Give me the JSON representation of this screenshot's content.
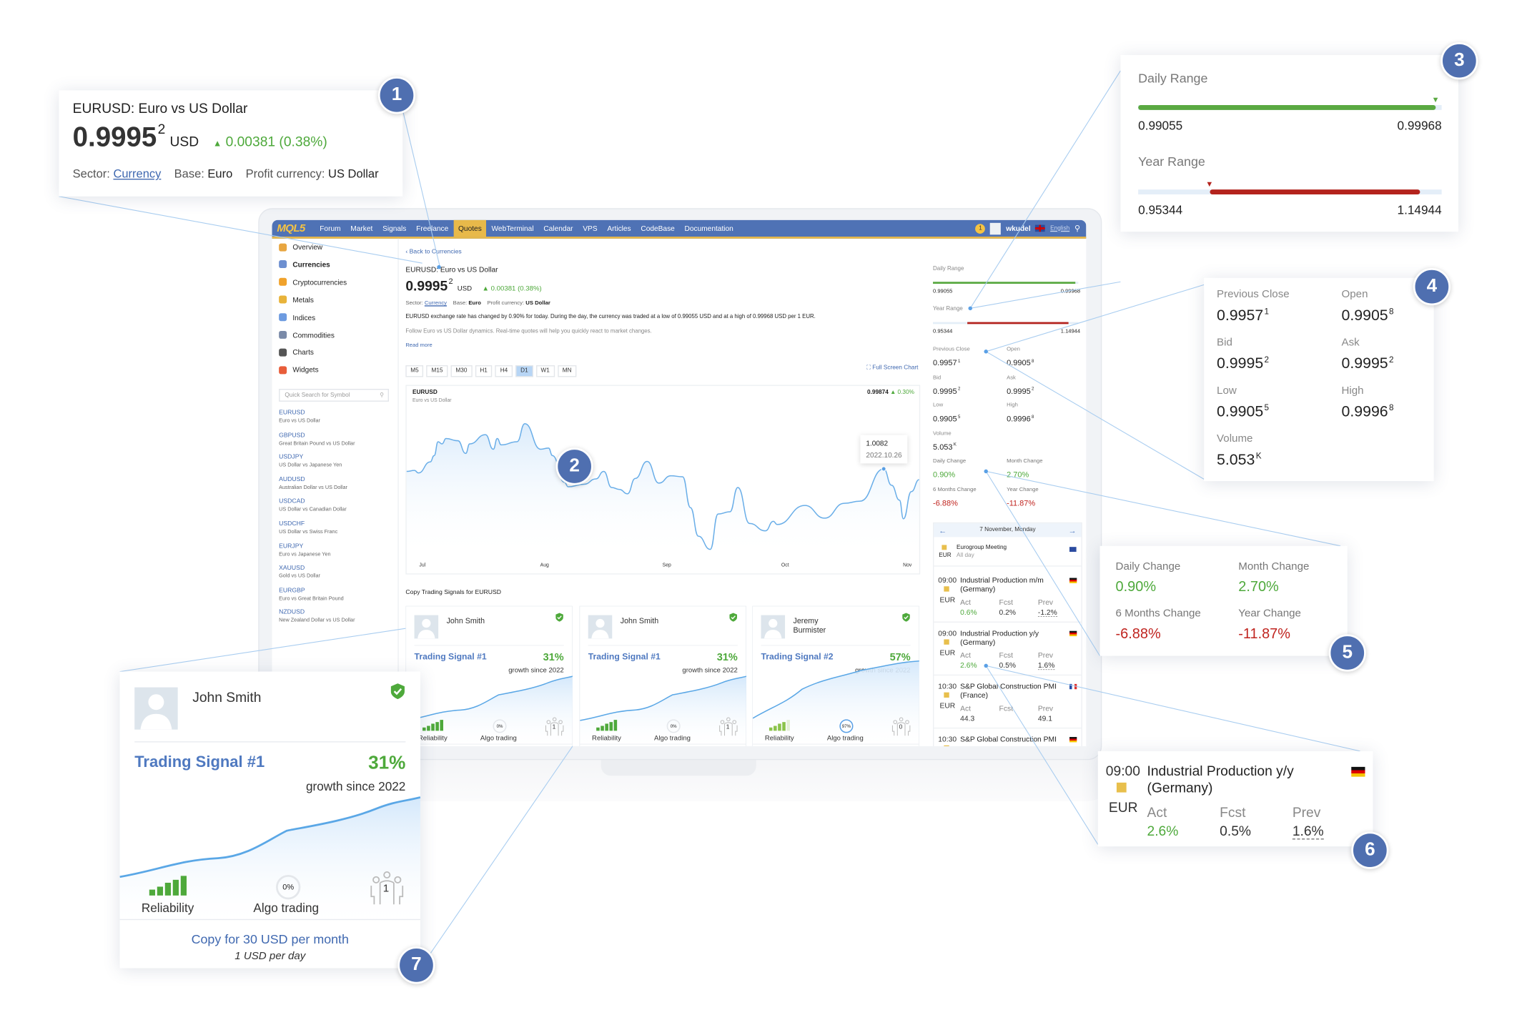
{
  "nav": {
    "logo": "MQL5",
    "items": [
      "Forum",
      "Market",
      "Signals",
      "Freelance",
      "Quotes",
      "WebTerminal",
      "Calendar",
      "VPS",
      "Articles",
      "CodeBase",
      "Documentation"
    ],
    "active": "Quotes",
    "notifications": "1",
    "user": "wkudel",
    "language": "English",
    "accent": "#4f72b5",
    "highlight": "#e8b94a"
  },
  "sidebar": {
    "menu": [
      {
        "label": "Overview",
        "icon": "overview-icon"
      },
      {
        "label": "Currencies",
        "icon": "currencies-icon"
      },
      {
        "label": "Cryptocurrencies",
        "icon": "crypto-icon"
      },
      {
        "label": "Metals",
        "icon": "metals-icon"
      },
      {
        "label": "Indices",
        "icon": "indices-icon"
      },
      {
        "label": "Commodities",
        "icon": "commodities-icon"
      },
      {
        "label": "Charts",
        "icon": "charts-icon"
      },
      {
        "label": "Widgets",
        "icon": "widgets-icon"
      }
    ],
    "search_placeholder": "Quick Search for Symbol",
    "symbols": [
      {
        "code": "EURUSD",
        "name": "Euro vs US Dollar"
      },
      {
        "code": "GBPUSD",
        "name": "Great Britain Pound vs US Dollar"
      },
      {
        "code": "USDJPY",
        "name": "US Dollar vs Japanese Yen"
      },
      {
        "code": "AUDUSD",
        "name": "Australian Dollar vs US Dollar"
      },
      {
        "code": "USDCAD",
        "name": "US Dollar vs Canadian Dollar"
      },
      {
        "code": "USDCHF",
        "name": "US Dollar vs Swiss Franc"
      },
      {
        "code": "EURJPY",
        "name": "Euro vs Japanese Yen"
      },
      {
        "code": "XAUUSD",
        "name": "Gold vs US Dollar"
      },
      {
        "code": "EURGBP",
        "name": "Euro vs Great Britain Pound"
      },
      {
        "code": "NZDUSD",
        "name": "New Zealand Dollar vs US Dollar"
      }
    ]
  },
  "main": {
    "back": "Back to Currencies",
    "title": "EURUSD: Euro vs US Dollar",
    "price": "0.9995",
    "price_sup": "2",
    "currency": "USD",
    "change": "0.00381 (0.38%)",
    "sector_label": "Sector:",
    "sector": "Currency",
    "base_label": "Base:",
    "base": "Euro",
    "profit_label": "Profit currency:",
    "profit": "US Dollar",
    "description": "EURUSD exchange rate has changed by 0.90% for today. During the day, the currency was traded at a low of 0.99055 USD and at a high of 0.99968 USD per 1 EUR.",
    "follow": "Follow Euro vs US Dollar dynamics. Real-time quotes will help you quickly react to market changes.",
    "read_more": "Read more",
    "timeframes": [
      "M5",
      "M15",
      "M30",
      "H1",
      "H4",
      "D1",
      "W1",
      "MN"
    ],
    "active_timeframe": "D1",
    "fullscreen": "Full Screen Chart"
  },
  "chart_data": {
    "type": "area",
    "symbol": "EURUSD",
    "subtitle": "Euro vs US Dollar",
    "last": "0.99874",
    "change": "0.30%",
    "x_ticks": [
      "Jul",
      "Aug",
      "Sep",
      "Oct",
      "Nov"
    ],
    "tick_dates": [
      "2022-07-01",
      "2022-08-01",
      "2022-09-01",
      "2022-10-01",
      "2022-11-01"
    ],
    "ylim": [
      0.955,
      1.045
    ],
    "grid": false,
    "color": "#6aaee8",
    "tooltip": {
      "value": "1.0082",
      "date": "2022.10.26"
    },
    "points": [
      [
        "2022-06-27",
        1.0067
      ],
      [
        "2022-06-29",
        1.0073
      ],
      [
        "2022-06-30",
        1.0058
      ],
      [
        "2022-07-03",
        1.0124
      ],
      [
        "2022-07-04",
        1.0162
      ],
      [
        "2022-07-05",
        1.0245
      ],
      [
        "2022-07-06",
        1.0232
      ],
      [
        "2022-07-07",
        1.0264
      ],
      [
        "2022-07-10",
        1.0251
      ],
      [
        "2022-07-12",
        1.0175
      ],
      [
        "2022-07-13",
        1.0232
      ],
      [
        "2022-07-17",
        1.0287
      ],
      [
        "2022-07-19",
        1.02
      ],
      [
        "2022-07-20",
        1.0264
      ],
      [
        "2022-07-21",
        1.0226
      ],
      [
        "2022-07-25",
        1.0245
      ],
      [
        "2022-07-27",
        1.0353
      ],
      [
        "2022-07-31",
        1.02
      ],
      [
        "2022-08-02",
        1.0207
      ],
      [
        "2022-08-03",
        1.0162
      ],
      [
        "2022-08-06",
        1.0003
      ],
      [
        "2022-08-07",
        0.9975
      ],
      [
        "2022-08-11",
        0.999
      ],
      [
        "2022-08-14",
        1.0022
      ],
      [
        "2022-08-16",
        1.0067
      ],
      [
        "2022-08-18",
        0.9971
      ],
      [
        "2022-08-20",
        0.9959
      ],
      [
        "2022-08-22",
        0.9933
      ],
      [
        "2022-08-24",
        1.0025
      ],
      [
        "2022-08-27",
        1.0127
      ],
      [
        "2022-08-30",
        0.9997
      ],
      [
        "2022-09-02",
        1.0041
      ],
      [
        "2022-09-05",
        1.0035
      ],
      [
        "2022-09-07",
        0.985
      ],
      [
        "2022-09-09",
        0.9679
      ],
      [
        "2022-09-12",
        0.96
      ],
      [
        "2022-09-14",
        0.9812
      ],
      [
        "2022-09-17",
        0.9825
      ],
      [
        "2022-09-19",
        0.9971
      ],
      [
        "2022-09-22",
        0.9755
      ],
      [
        "2022-09-26",
        0.9711
      ],
      [
        "2022-09-28",
        0.9768
      ],
      [
        "2022-09-29",
        0.9749
      ],
      [
        "2022-10-06",
        0.9863
      ],
      [
        "2022-10-11",
        0.9787
      ],
      [
        "2022-10-16",
        0.9876
      ],
      [
        "2022-10-20",
        0.9889
      ],
      [
        "2022-10-26",
        1.0082
      ],
      [
        "2022-10-28",
        0.9984
      ],
      [
        "2022-10-30",
        0.9895
      ],
      [
        "2022-10-31",
        0.9783
      ],
      [
        "2022-11-02",
        0.9946
      ],
      [
        "2022-11-04",
        1.0018
      ]
    ]
  },
  "signals": {
    "header": "Copy Trading Signals for EURUSD",
    "cards": [
      {
        "name": "John Smith",
        "title": "Trading Signal #1",
        "growth": "31%",
        "growth_label": "growth since 2022",
        "reliability": 5,
        "reliability_label": "Reliability",
        "algo": "0%",
        "algo_label": "Algo trading",
        "subscribers": "1",
        "copy": "Copy for 30 USD per month",
        "per_day": "1 USD per day"
      },
      {
        "name": "John Smith",
        "title": "Trading Signal #1",
        "growth": "31%",
        "growth_label": "growth since 2022",
        "reliability": 5,
        "reliability_label": "Reliability",
        "algo": "0%",
        "algo_label": "Algo trading",
        "subscribers": "1"
      },
      {
        "name": "Jeremy Burmister",
        "title": "Trading Signal #2",
        "growth": "57%",
        "growth_label": "growth since 2022",
        "reliability": 4,
        "reliability_label": "Reliability",
        "algo": "97%",
        "algo_label": "Algo trading",
        "subscribers": "0"
      }
    ]
  },
  "ranges": {
    "daily_label": "Daily Range",
    "daily_low": "0.99055",
    "daily_high": "0.99968",
    "daily_position": 0.98,
    "year_label": "Year Range",
    "year_low": "0.95344",
    "year_high": "1.14944",
    "year_position": 0.235
  },
  "stats": [
    {
      "label": "Previous Close",
      "value": "0.9957",
      "sup": "1"
    },
    {
      "label": "Open",
      "value": "0.9905",
      "sup": "8"
    },
    {
      "label": "Bid",
      "value": "0.9995",
      "sup": "2"
    },
    {
      "label": "Ask",
      "value": "0.9995",
      "sup": "2"
    },
    {
      "label": "Low",
      "value": "0.9905",
      "sup": "5"
    },
    {
      "label": "High",
      "value": "0.9996",
      "sup": "8"
    },
    {
      "label": "Volume",
      "value": "5.053",
      "sup": "K"
    }
  ],
  "changes": [
    {
      "label": "Daily Change",
      "value": "0.90%",
      "dir": "up"
    },
    {
      "label": "Month Change",
      "value": "2.70%",
      "dir": "up"
    },
    {
      "label": "6 Months Change",
      "value": "-6.88%",
      "dir": "down"
    },
    {
      "label": "Year Change",
      "value": "-11.87%",
      "dir": "down"
    }
  ],
  "calendar": {
    "date": "7 November, Monday",
    "first": {
      "title": "Eurogroup Meeting",
      "sub": "All day",
      "currency": "EUR"
    },
    "act_label": "Act",
    "fcst_label": "Fcst",
    "prev_label": "Prev",
    "events": [
      {
        "time": "09:00",
        "currency": "EUR",
        "title": "Industrial Production m/m (Germany)",
        "act": "0.6%",
        "fcst": "0.2%",
        "prev": "-1.2%",
        "flag": "de"
      },
      {
        "time": "09:00",
        "currency": "EUR",
        "title": "Industrial Production y/y (Germany)",
        "act": "2.6%",
        "fcst": "0.5%",
        "prev": "1.6%",
        "flag": "de"
      },
      {
        "time": "10:30",
        "currency": "EUR",
        "title": "S&P Global Construction PMI (France)",
        "act": "44.3",
        "fcst": "",
        "prev": "49.1",
        "flag": "fr"
      },
      {
        "time": "10:30",
        "currency": "EUR",
        "title": "S&P Global Construction PMI",
        "act": "",
        "fcst": "",
        "prev": "",
        "flag": "de"
      }
    ]
  },
  "badges": [
    "1",
    "2",
    "3",
    "4",
    "5",
    "6",
    "7"
  ]
}
